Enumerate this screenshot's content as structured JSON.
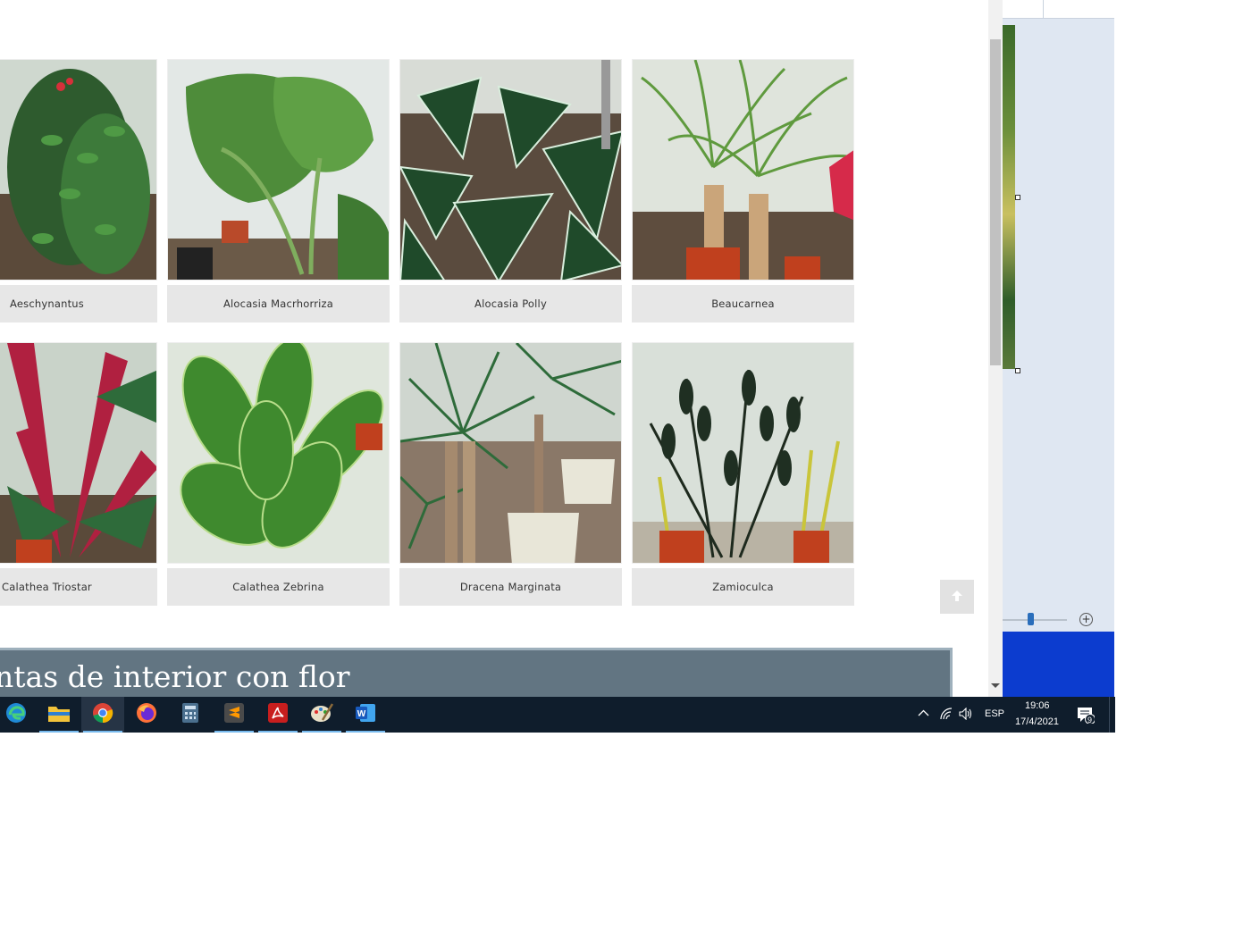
{
  "gallery": {
    "rows": [
      [
        {
          "name": "Aeschynantus",
          "icon": "plant-photo"
        },
        {
          "name": "Alocasia Macrhorriza",
          "icon": "plant-photo"
        },
        {
          "name": "Alocasia Polly",
          "icon": "plant-photo"
        },
        {
          "name": "Beaucarnea",
          "icon": "plant-photo"
        }
      ],
      [
        {
          "name": "Calathea Triostar",
          "icon": "plant-photo"
        },
        {
          "name": "Calathea Zebrina",
          "icon": "plant-photo"
        },
        {
          "name": "Dracena Marginata",
          "icon": "plant-photo"
        },
        {
          "name": "Zamioculca",
          "icon": "plant-photo"
        }
      ]
    ]
  },
  "section": {
    "title": "ntas de interior con flor"
  },
  "scroll_top": {
    "icon": "arrow-up-icon"
  },
  "taskbar": {
    "apps": [
      {
        "name": "edge",
        "icon": "edge-icon",
        "active": false
      },
      {
        "name": "file-explorer",
        "icon": "folder-icon",
        "active": false
      },
      {
        "name": "chrome",
        "icon": "chrome-icon",
        "active": true
      },
      {
        "name": "firefox",
        "icon": "firefox-icon",
        "active": false
      },
      {
        "name": "calculator",
        "icon": "calculator-icon",
        "active": false
      },
      {
        "name": "sublime-text",
        "icon": "sublime-icon",
        "active": false
      },
      {
        "name": "acrobat",
        "icon": "acrobat-icon",
        "active": false
      },
      {
        "name": "paint",
        "icon": "paint-icon",
        "active": false
      },
      {
        "name": "word",
        "icon": "word-icon",
        "active": false
      }
    ],
    "tray": {
      "language": "ESP",
      "time": "19:06",
      "date": "17/4/2021",
      "notifications_count": "9"
    }
  },
  "colors": {
    "caption_bg": "#e7e7e7",
    "section_bg": "#627582",
    "taskbar_bg": "#0f1d2c",
    "active_indicator": "#76b9ed"
  }
}
